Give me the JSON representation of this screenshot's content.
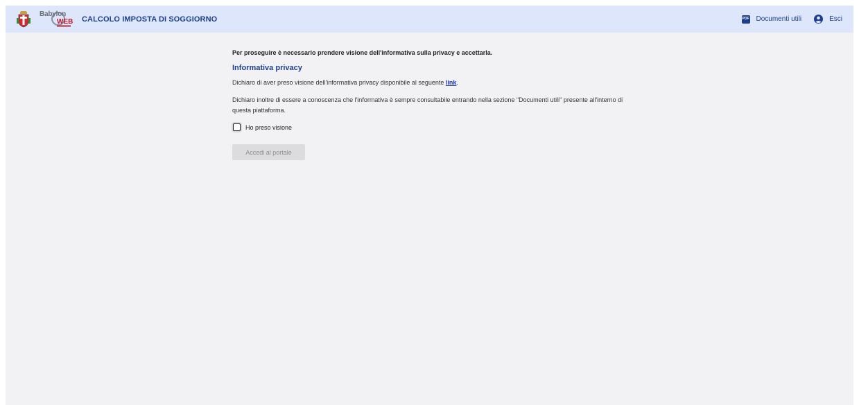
{
  "header": {
    "title": "CALCOLO IMPOSTA DI SOGGIORNO",
    "logo_text_1": "Babylon",
    "logo_text_2": "WEB",
    "documents_label": "Documenti utili",
    "documents_icon": "PDF",
    "logout_label": "Esci",
    "accent_color": "#1d3f8c",
    "bar_color": "#dde6fb"
  },
  "privacy": {
    "intro": "Per proseguire è necessario prendere visione dell'informativa sulla privacy e accettarla.",
    "title": "Informativa privacy",
    "paragraph1_before_link": "Dichiaro di aver preso visione dell'informativa privacy disponibile al seguente ",
    "link_label": "link",
    "paragraph1_after_link": ".",
    "paragraph2": "Dichiaro inoltre di essere a conoscenza che l'informativa è sempre consultabile entrando nella sezione \"Documenti utili\" presente all'interno di questa piattaforma.",
    "checkbox_label": "Ho preso visione",
    "checkbox_checked": false,
    "submit_label": "Accedi al portale",
    "submit_disabled": true
  },
  "icons": {
    "crest": "municipal-crest-icon",
    "documents": "pdf-icon",
    "logout": "user-circle-icon"
  }
}
